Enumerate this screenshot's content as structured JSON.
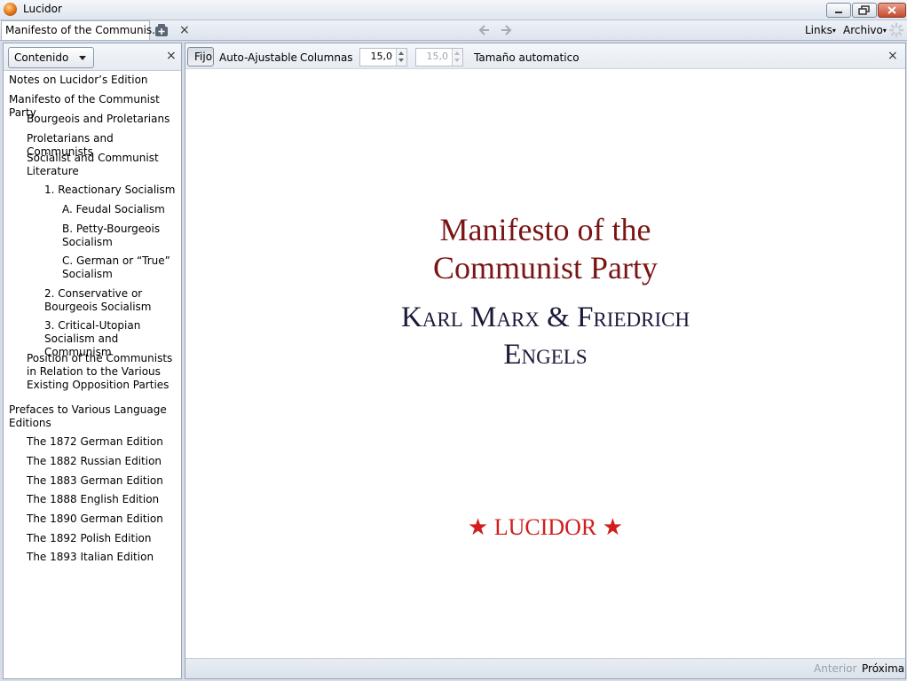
{
  "window": {
    "title": "Lucidor"
  },
  "tabbar": {
    "active_tab": "Manifesto of the Communis...",
    "menus": {
      "links": "Links",
      "archivo": "Archivo"
    }
  },
  "sidebar": {
    "dropdown_label": "Contenido",
    "close": "×",
    "toc": [
      {
        "label": "Notes on Lucidor’s Edition",
        "level": 0
      },
      {
        "label": "Manifesto of the Communist Party",
        "level": 0
      },
      {
        "label": "Bourgeois and Proletarians",
        "level": 1
      },
      {
        "label": "Proletarians and Communists",
        "level": 1
      },
      {
        "label": "Socialist and Communist Literature",
        "level": 1
      },
      {
        "label": "1. Reactionary Socialism",
        "level": 2
      },
      {
        "label": "A. Feudal Socialism",
        "level": 3
      },
      {
        "label": "B. Petty-Bourgeois Socialism",
        "level": 3
      },
      {
        "label": "C. German or “True” Socialism",
        "level": 3
      },
      {
        "label": "2. Conservative or Bourgeois Socialism",
        "level": 2
      },
      {
        "label": "3. Critical-Utopian Socialism and Communism",
        "level": 2
      },
      {
        "label": "Position of the Communists in Relation to the Various Existing Opposition Parties",
        "level": 1
      },
      {
        "label": "Prefaces to Various Language Editions",
        "level": 0
      },
      {
        "label": "The 1872 German Edition",
        "level": 1
      },
      {
        "label": "The 1882 Russian Edition",
        "level": 1
      },
      {
        "label": "The 1883 German Edition",
        "level": 1
      },
      {
        "label": "The 1888 English Edition",
        "level": 1
      },
      {
        "label": "The 1890 German Edition",
        "level": 1
      },
      {
        "label": "The 1892 Polish Edition",
        "level": 1
      },
      {
        "label": "The 1893 Italian Edition",
        "level": 1
      }
    ]
  },
  "toolbar": {
    "fijo": "Fijo",
    "auto": "Auto-Ajustable",
    "columnas": "Columnas",
    "spin1": "15,0",
    "spin2": "15,0",
    "tamano": "Tamaño automatico",
    "close": "×"
  },
  "page": {
    "title_line1": "Manifesto of the",
    "title_line2": "Communist Party",
    "author_line1": "Karl Marx & Friedrich",
    "author_line2": "Engels",
    "imprint": "LUCIDOR",
    "star": "★"
  },
  "status": {
    "prev": "Anterior",
    "next": "Próxima"
  },
  "colors": {
    "title": "#7b1515",
    "author": "#1a1a3a",
    "imprint": "#d11d1d"
  }
}
